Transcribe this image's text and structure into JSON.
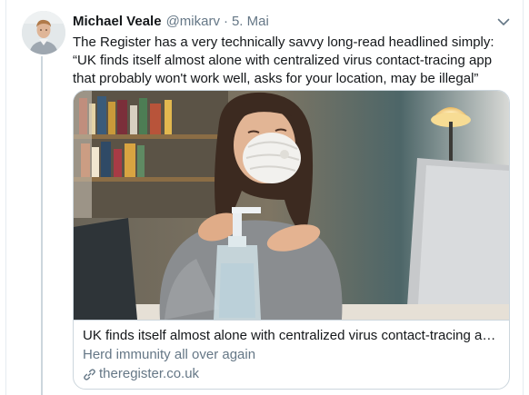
{
  "tweet": {
    "author_name": "Michael Veale",
    "handle": "@mikarv",
    "separator": "·",
    "date": "5. Mai",
    "text": "The Register has a very technically savvy long-read headlined simply: “UK finds itself almost alone with centralized virus contact-tracing app that probably won't work well, asks for your location, may be illegal”"
  },
  "card": {
    "title": "UK finds itself almost alone with centralized virus contact-tracing ap...",
    "description": "Herd immunity all over again",
    "domain": "theregister.co.uk"
  },
  "icons": {
    "menu": "chevron-down-icon",
    "link": "link-icon"
  },
  "colors": {
    "text_primary": "#14171a",
    "text_secondary": "#657786",
    "border": "#ccd6dd",
    "thread_line": "#ccd6dd"
  }
}
